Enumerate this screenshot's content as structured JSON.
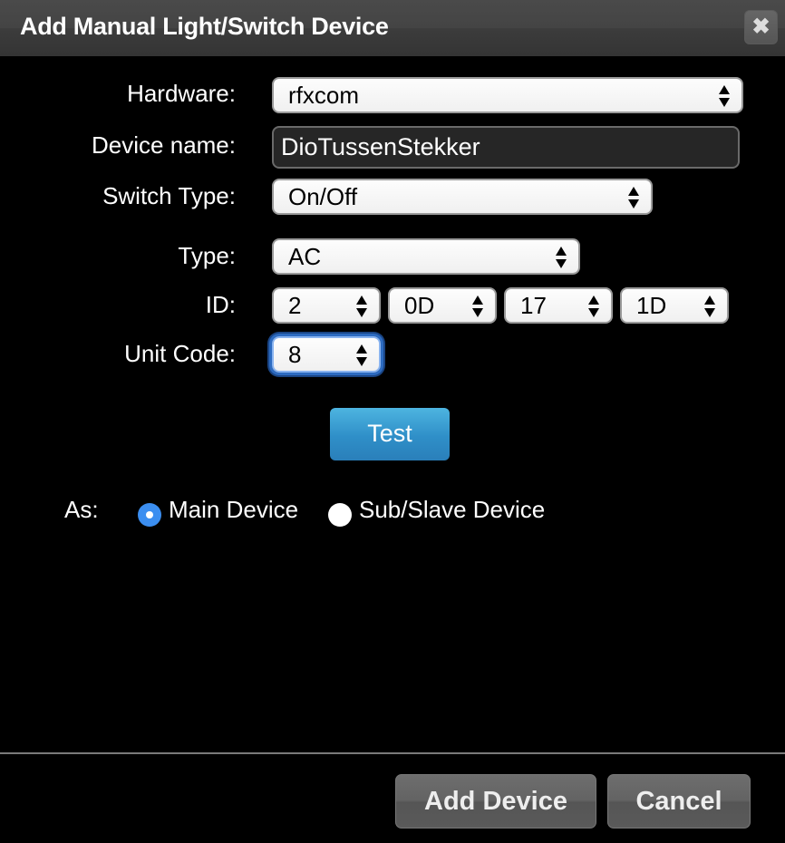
{
  "dialog": {
    "title": "Add Manual Light/Switch Device",
    "close_icon": "close-icon"
  },
  "form": {
    "hardware": {
      "label": "Hardware:",
      "value": "rfxcom"
    },
    "device_name": {
      "label": "Device name:",
      "value": "DioTussenStekker"
    },
    "switch_type": {
      "label": "Switch Type:",
      "value": "On/Off"
    },
    "type": {
      "label": "Type:",
      "value": "AC"
    },
    "id": {
      "label": "ID:",
      "values": [
        "2",
        "0D",
        "17",
        "1D"
      ]
    },
    "unit_code": {
      "label": "Unit Code:",
      "value": "8"
    }
  },
  "test_button": {
    "label": "Test",
    "color": "#2f8fc8"
  },
  "as": {
    "label": "As:",
    "options": [
      {
        "label": "Main Device",
        "checked": true
      },
      {
        "label": "Sub/Slave Device",
        "checked": false
      }
    ]
  },
  "footer": {
    "add_label": "Add Device",
    "cancel_label": "Cancel"
  }
}
